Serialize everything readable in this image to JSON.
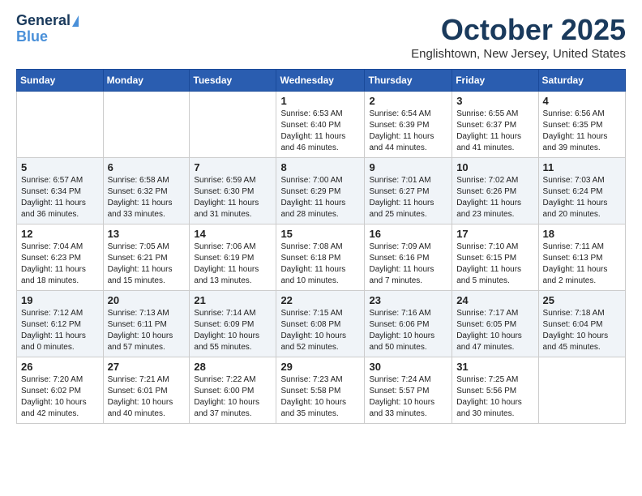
{
  "header": {
    "logo_general": "General",
    "logo_blue": "Blue",
    "title": "October 2025",
    "subtitle": "Englishtown, New Jersey, United States"
  },
  "days_of_week": [
    "Sunday",
    "Monday",
    "Tuesday",
    "Wednesday",
    "Thursday",
    "Friday",
    "Saturday"
  ],
  "weeks": [
    [
      {
        "day": "",
        "info": ""
      },
      {
        "day": "",
        "info": ""
      },
      {
        "day": "",
        "info": ""
      },
      {
        "day": "1",
        "info": "Sunrise: 6:53 AM\nSunset: 6:40 PM\nDaylight: 11 hours\nand 46 minutes."
      },
      {
        "day": "2",
        "info": "Sunrise: 6:54 AM\nSunset: 6:39 PM\nDaylight: 11 hours\nand 44 minutes."
      },
      {
        "day": "3",
        "info": "Sunrise: 6:55 AM\nSunset: 6:37 PM\nDaylight: 11 hours\nand 41 minutes."
      },
      {
        "day": "4",
        "info": "Sunrise: 6:56 AM\nSunset: 6:35 PM\nDaylight: 11 hours\nand 39 minutes."
      }
    ],
    [
      {
        "day": "5",
        "info": "Sunrise: 6:57 AM\nSunset: 6:34 PM\nDaylight: 11 hours\nand 36 minutes."
      },
      {
        "day": "6",
        "info": "Sunrise: 6:58 AM\nSunset: 6:32 PM\nDaylight: 11 hours\nand 33 minutes."
      },
      {
        "day": "7",
        "info": "Sunrise: 6:59 AM\nSunset: 6:30 PM\nDaylight: 11 hours\nand 31 minutes."
      },
      {
        "day": "8",
        "info": "Sunrise: 7:00 AM\nSunset: 6:29 PM\nDaylight: 11 hours\nand 28 minutes."
      },
      {
        "day": "9",
        "info": "Sunrise: 7:01 AM\nSunset: 6:27 PM\nDaylight: 11 hours\nand 25 minutes."
      },
      {
        "day": "10",
        "info": "Sunrise: 7:02 AM\nSunset: 6:26 PM\nDaylight: 11 hours\nand 23 minutes."
      },
      {
        "day": "11",
        "info": "Sunrise: 7:03 AM\nSunset: 6:24 PM\nDaylight: 11 hours\nand 20 minutes."
      }
    ],
    [
      {
        "day": "12",
        "info": "Sunrise: 7:04 AM\nSunset: 6:23 PM\nDaylight: 11 hours\nand 18 minutes."
      },
      {
        "day": "13",
        "info": "Sunrise: 7:05 AM\nSunset: 6:21 PM\nDaylight: 11 hours\nand 15 minutes."
      },
      {
        "day": "14",
        "info": "Sunrise: 7:06 AM\nSunset: 6:19 PM\nDaylight: 11 hours\nand 13 minutes."
      },
      {
        "day": "15",
        "info": "Sunrise: 7:08 AM\nSunset: 6:18 PM\nDaylight: 11 hours\nand 10 minutes."
      },
      {
        "day": "16",
        "info": "Sunrise: 7:09 AM\nSunset: 6:16 PM\nDaylight: 11 hours\nand 7 minutes."
      },
      {
        "day": "17",
        "info": "Sunrise: 7:10 AM\nSunset: 6:15 PM\nDaylight: 11 hours\nand 5 minutes."
      },
      {
        "day": "18",
        "info": "Sunrise: 7:11 AM\nSunset: 6:13 PM\nDaylight: 11 hours\nand 2 minutes."
      }
    ],
    [
      {
        "day": "19",
        "info": "Sunrise: 7:12 AM\nSunset: 6:12 PM\nDaylight: 11 hours\nand 0 minutes."
      },
      {
        "day": "20",
        "info": "Sunrise: 7:13 AM\nSunset: 6:11 PM\nDaylight: 10 hours\nand 57 minutes."
      },
      {
        "day": "21",
        "info": "Sunrise: 7:14 AM\nSunset: 6:09 PM\nDaylight: 10 hours\nand 55 minutes."
      },
      {
        "day": "22",
        "info": "Sunrise: 7:15 AM\nSunset: 6:08 PM\nDaylight: 10 hours\nand 52 minutes."
      },
      {
        "day": "23",
        "info": "Sunrise: 7:16 AM\nSunset: 6:06 PM\nDaylight: 10 hours\nand 50 minutes."
      },
      {
        "day": "24",
        "info": "Sunrise: 7:17 AM\nSunset: 6:05 PM\nDaylight: 10 hours\nand 47 minutes."
      },
      {
        "day": "25",
        "info": "Sunrise: 7:18 AM\nSunset: 6:04 PM\nDaylight: 10 hours\nand 45 minutes."
      }
    ],
    [
      {
        "day": "26",
        "info": "Sunrise: 7:20 AM\nSunset: 6:02 PM\nDaylight: 10 hours\nand 42 minutes."
      },
      {
        "day": "27",
        "info": "Sunrise: 7:21 AM\nSunset: 6:01 PM\nDaylight: 10 hours\nand 40 minutes."
      },
      {
        "day": "28",
        "info": "Sunrise: 7:22 AM\nSunset: 6:00 PM\nDaylight: 10 hours\nand 37 minutes."
      },
      {
        "day": "29",
        "info": "Sunrise: 7:23 AM\nSunset: 5:58 PM\nDaylight: 10 hours\nand 35 minutes."
      },
      {
        "day": "30",
        "info": "Sunrise: 7:24 AM\nSunset: 5:57 PM\nDaylight: 10 hours\nand 33 minutes."
      },
      {
        "day": "31",
        "info": "Sunrise: 7:25 AM\nSunset: 5:56 PM\nDaylight: 10 hours\nand 30 minutes."
      },
      {
        "day": "",
        "info": ""
      }
    ]
  ]
}
